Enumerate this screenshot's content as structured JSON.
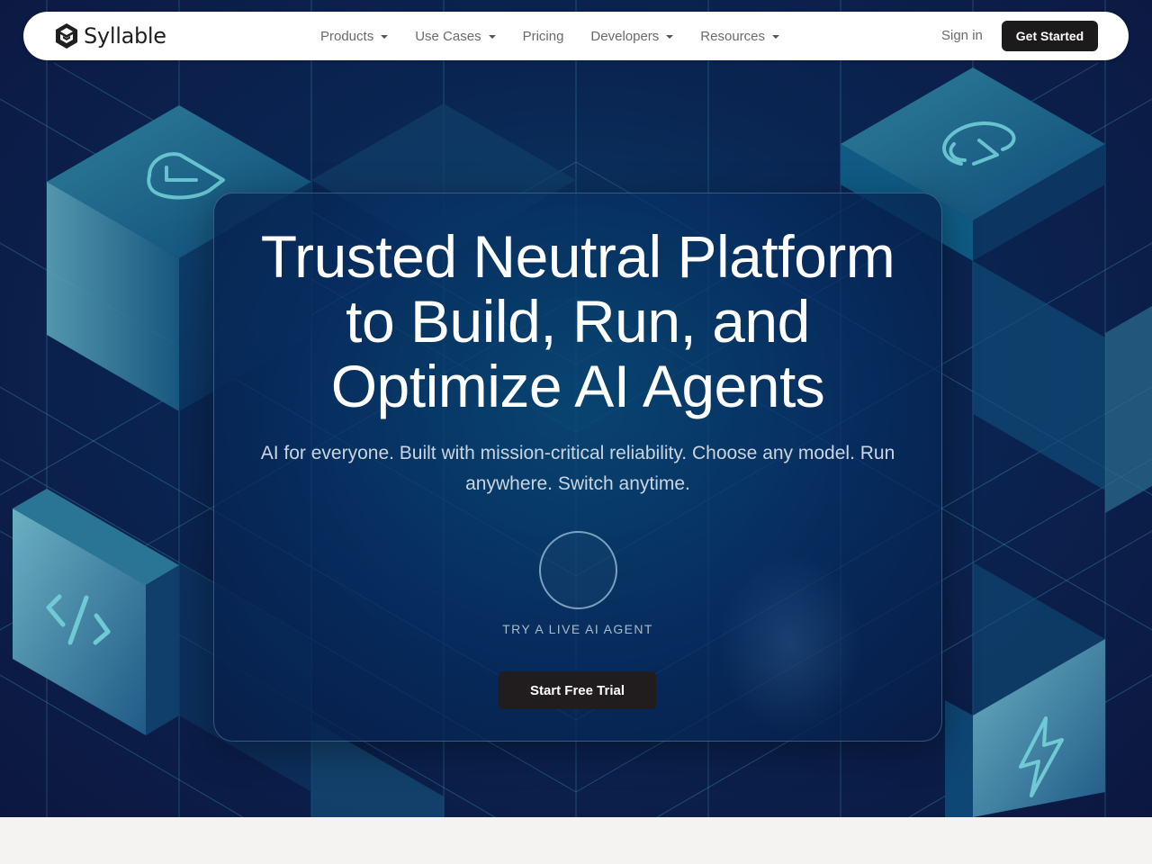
{
  "nav": {
    "brand": "Syllable",
    "links": [
      {
        "label": "Products",
        "dropdown": true
      },
      {
        "label": "Use Cases",
        "dropdown": true
      },
      {
        "label": "Pricing",
        "dropdown": false
      },
      {
        "label": "Developers",
        "dropdown": true
      },
      {
        "label": "Resources",
        "dropdown": true
      }
    ],
    "sign_in": "Sign in",
    "get_started": "Get Started"
  },
  "hero": {
    "title": "Trusted Neutral Platform to Build, Run, and Optimize AI Agents",
    "subtitle": "AI for everyone. Built with mission-critical reliability. Choose any model. Run anywhere. Switch anytime.",
    "agent_label": "TRY A LIVE AI AGENT",
    "cta": "Start Free Trial"
  },
  "colors": {
    "bg_dark": "#0c1740",
    "accent_teal": "#5fb3c4",
    "button_dark": "#1d1a1b",
    "page_light": "#f4f3f1"
  },
  "icons": [
    "syllable-logo-icon",
    "shield-icon",
    "refresh-icon",
    "code-icon",
    "lightning-icon",
    "chevron-down-icon"
  ]
}
